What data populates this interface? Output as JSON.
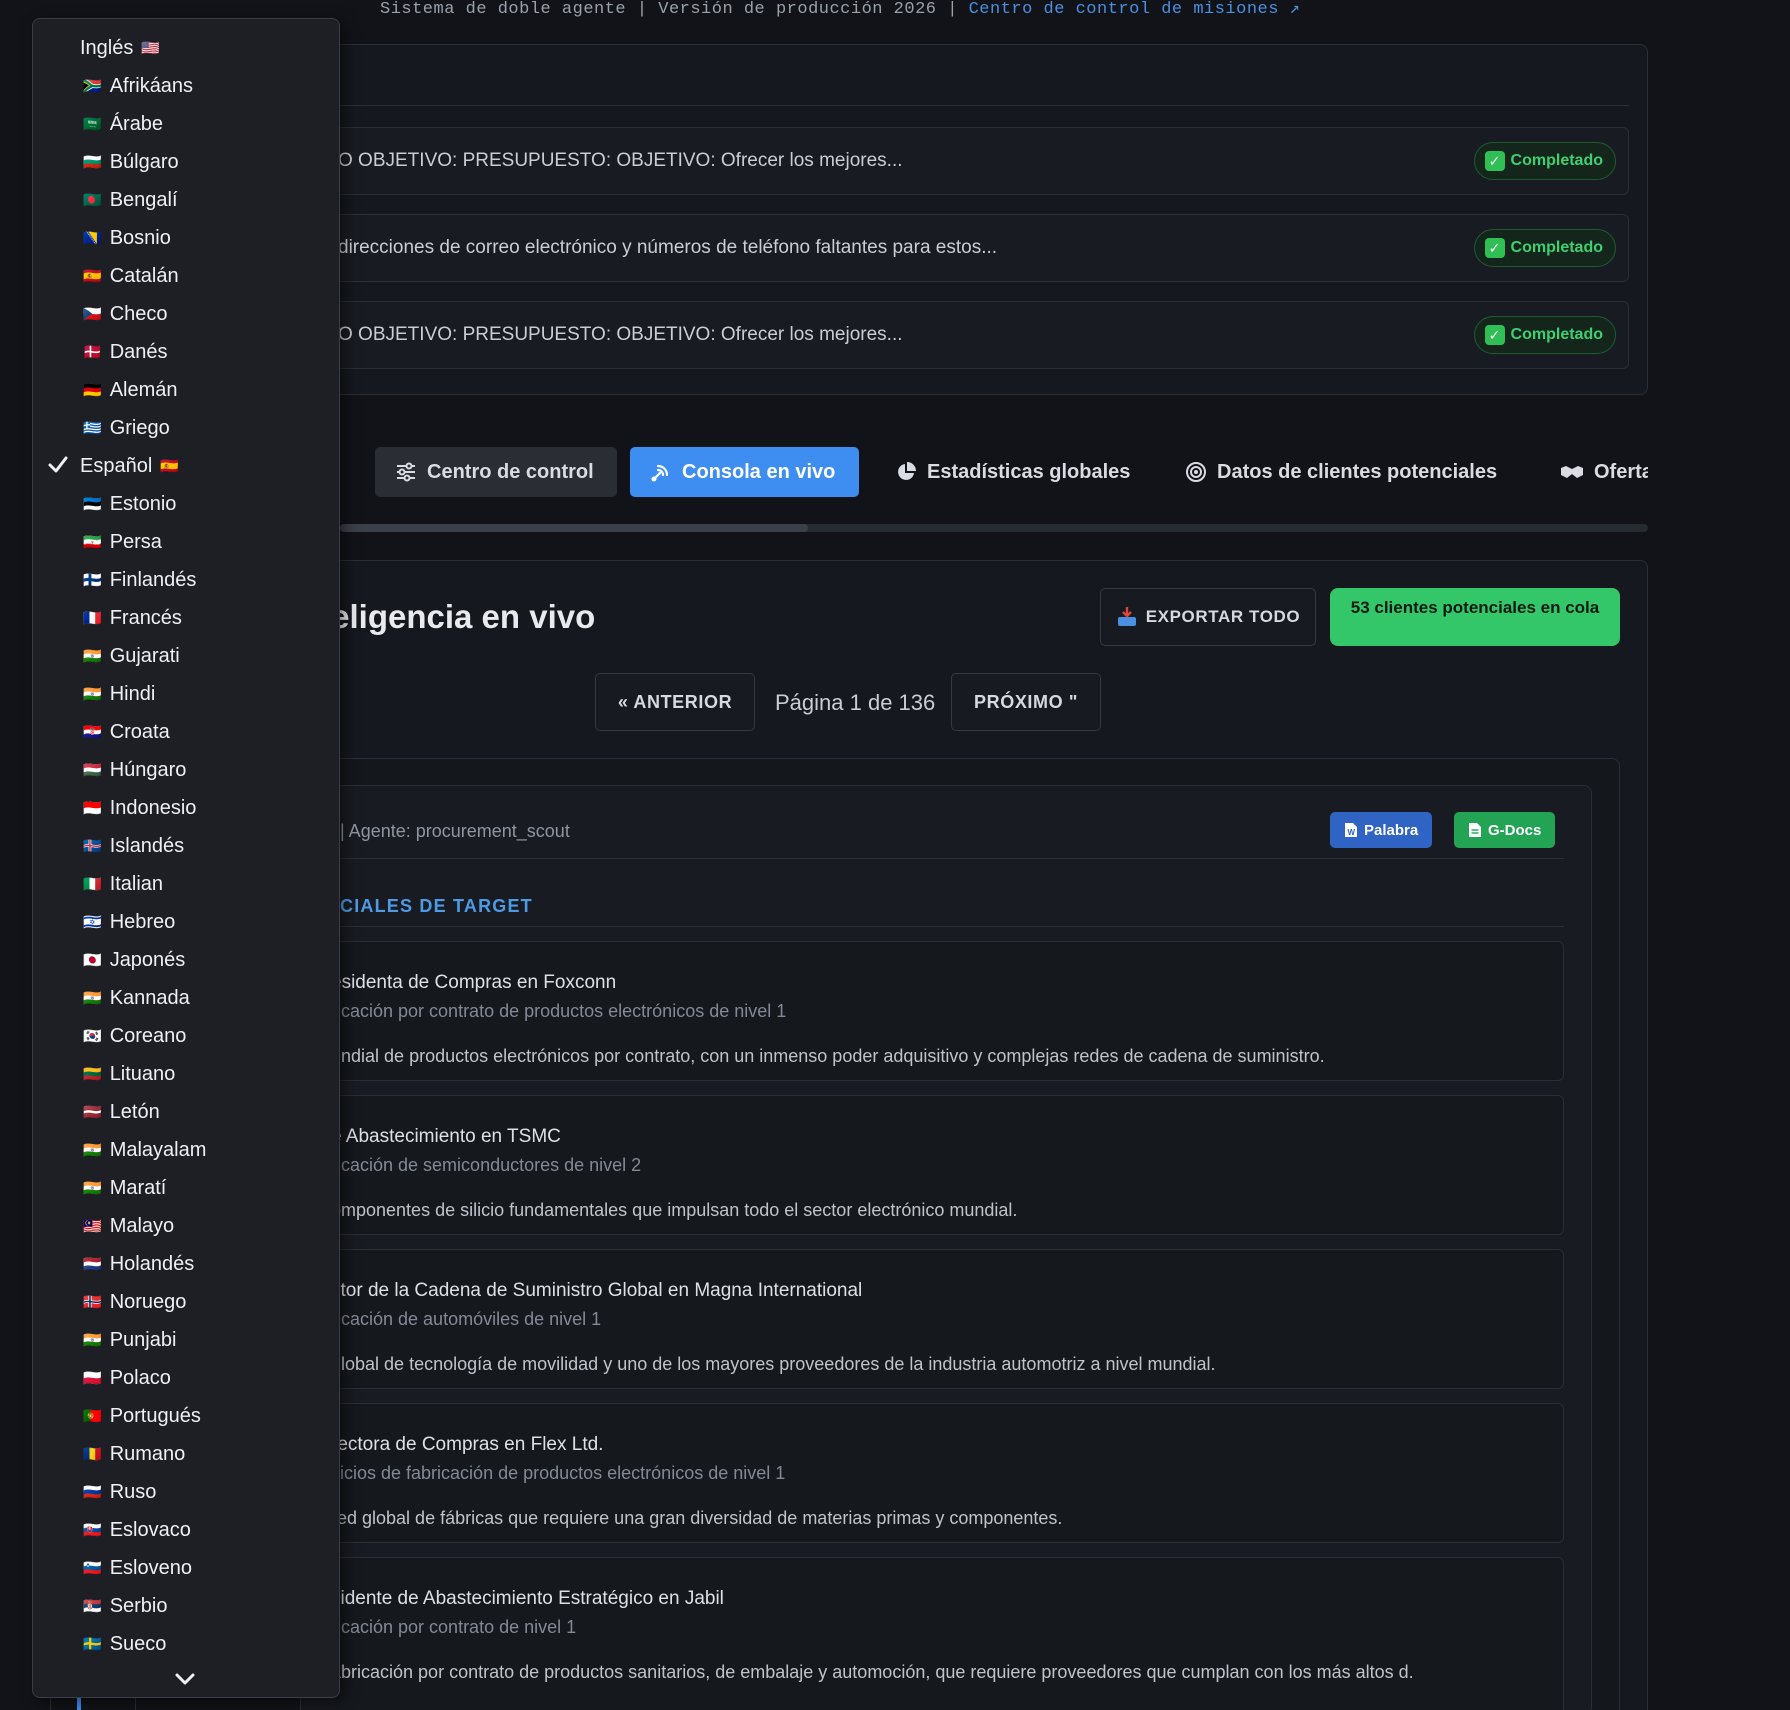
{
  "header": {
    "line": "Sistema de doble agente | Versión de producción 2026 | ",
    "link": "Centro de control de misiones ↗"
  },
  "tasks": [
    {
      "text": "O OBJETIVO: PRESUPUESTO: OBJETIVO: Ofrecer los mejores...",
      "status": "Completado"
    },
    {
      "text": "direcciones de correo electrónico y números de teléfono faltantes para estos...",
      "status": "Completado"
    },
    {
      "text": "O OBJETIVO: PRESUPUESTO: OBJETIVO: Ofrecer los mejores...",
      "status": "Completado"
    }
  ],
  "tabs": [
    {
      "label": "Centro de control",
      "icon": "sliders-icon"
    },
    {
      "label": "Consola en vivo",
      "icon": "broadcast-icon"
    },
    {
      "label": "Estadísticas globales",
      "icon": "pie-chart-icon"
    },
    {
      "label": "Datos de clientes potenciales",
      "icon": "target-icon"
    },
    {
      "label": "Oferta",
      "icon": "handshake-icon"
    }
  ],
  "main": {
    "title": "nteligencia en vivo",
    "export_label": "EXPORTAR TODO",
    "queue_label": "53 clientes potenciales en cola",
    "prev_label": "« ANTERIOR",
    "page_info": "Página 1 de 136",
    "next_label": "PRÓXIMO \""
  },
  "report": {
    "agent": "| Agente: procurement_scout",
    "word_label": "Palabra",
    "gdocs_label": "G-Docs",
    "section_title": "CIALES DE TARGET",
    "leads": [
      {
        "name": "esidenta de Compras en Foxconn",
        "sector": "ricación por contrato de productos electrónicos de nivel 1",
        "desc": "undial de productos electrónicos por contrato, con un inmenso poder adquisitivo y complejas redes de cadena de suministro."
      },
      {
        "name": "e Abastecimiento en TSMC",
        "sector": "ricación de semiconductores de nivel 2",
        "desc": "omponentes de silicio fundamentales que impulsan todo el sector electrónico mundial."
      },
      {
        "name": "ctor de la Cadena de Suministro Global en Magna International",
        "sector": "ricación de automóviles de nivel 1",
        "desc": "global de tecnología de movilidad y uno de los mayores proveedores de la industria automotriz a nivel mundial."
      },
      {
        "name": "rectora de Compras en Flex Ltd.",
        "sector": "vicios de fabricación de productos electrónicos de nivel 1",
        "desc": "red global de fábricas que requiere una gran diversidad de materias primas y componentes."
      },
      {
        "name": "sidente de Abastecimiento Estratégico en Jabil",
        "sector": "ricación por contrato de nivel 1",
        "desc": "abricación por contrato de productos sanitarios, de embalaje y automoción, que requiere proveedores que cumplan con los más altos d."
      }
    ]
  },
  "languages": {
    "current": {
      "label": "Inglés",
      "flag": "🇺🇸"
    },
    "selected": {
      "label": "Español",
      "flag": "🇪🇸"
    },
    "items": [
      {
        "label": "Afrikáans",
        "flag": "🇿🇦"
      },
      {
        "label": "Árabe",
        "flag": "🇸🇦"
      },
      {
        "label": "Búlgaro",
        "flag": "🇧🇬"
      },
      {
        "label": "Bengalí",
        "flag": "🇧🇩"
      },
      {
        "label": "Bosnio",
        "flag": "🇧🇦"
      },
      {
        "label": "Catalán",
        "flag": "🇪🇸"
      },
      {
        "label": "Checo",
        "flag": "🇨🇿"
      },
      {
        "label": "Danés",
        "flag": "🇩🇰"
      },
      {
        "label": "Alemán",
        "flag": "🇩🇪"
      },
      {
        "label": "Griego",
        "flag": "🇬🇷"
      },
      {
        "label": "Español",
        "flag": "🇪🇸"
      },
      {
        "label": "Estonio",
        "flag": "🇪🇪"
      },
      {
        "label": "Persa",
        "flag": "🇮🇷"
      },
      {
        "label": "Finlandés",
        "flag": "🇫🇮"
      },
      {
        "label": "Francés",
        "flag": "🇫🇷"
      },
      {
        "label": "Gujarati",
        "flag": "🇮🇳"
      },
      {
        "label": "Hindi",
        "flag": "🇮🇳"
      },
      {
        "label": "Croata",
        "flag": "🇭🇷"
      },
      {
        "label": "Húngaro",
        "flag": "🇭🇺"
      },
      {
        "label": "Indonesio",
        "flag": "🇮🇩"
      },
      {
        "label": "Islandés",
        "flag": "🇮🇸"
      },
      {
        "label": "Italian",
        "flag": "🇮🇹"
      },
      {
        "label": "Hebreo",
        "flag": "🇮🇱"
      },
      {
        "label": "Japonés",
        "flag": "🇯🇵"
      },
      {
        "label": "Kannada",
        "flag": "🇮🇳"
      },
      {
        "label": "Coreano",
        "flag": "🇰🇷"
      },
      {
        "label": "Lituano",
        "flag": "🇱🇹"
      },
      {
        "label": "Letón",
        "flag": "🇱🇻"
      },
      {
        "label": "Malayalam",
        "flag": "🇮🇳"
      },
      {
        "label": "Maratí",
        "flag": "🇮🇳"
      },
      {
        "label": "Malayo",
        "flag": "🇲🇾"
      },
      {
        "label": "Holandés",
        "flag": "🇳🇱"
      },
      {
        "label": "Noruego",
        "flag": "🇳🇴"
      },
      {
        "label": "Punjabi",
        "flag": "🇮🇳"
      },
      {
        "label": "Polaco",
        "flag": "🇵🇱"
      },
      {
        "label": "Portugués",
        "flag": "🇵🇹"
      },
      {
        "label": "Rumano",
        "flag": "🇷🇴"
      },
      {
        "label": "Ruso",
        "flag": "🇷🇺"
      },
      {
        "label": "Eslovaco",
        "flag": "🇸🇰"
      },
      {
        "label": "Esloveno",
        "flag": "🇸🇮"
      },
      {
        "label": "Serbio",
        "flag": "🇷🇸"
      },
      {
        "label": "Sueco",
        "flag": "🇸🇪"
      }
    ]
  },
  "colors": {
    "accent": "#3d8ef0",
    "success": "#34c76a",
    "link": "#4d9be6"
  }
}
